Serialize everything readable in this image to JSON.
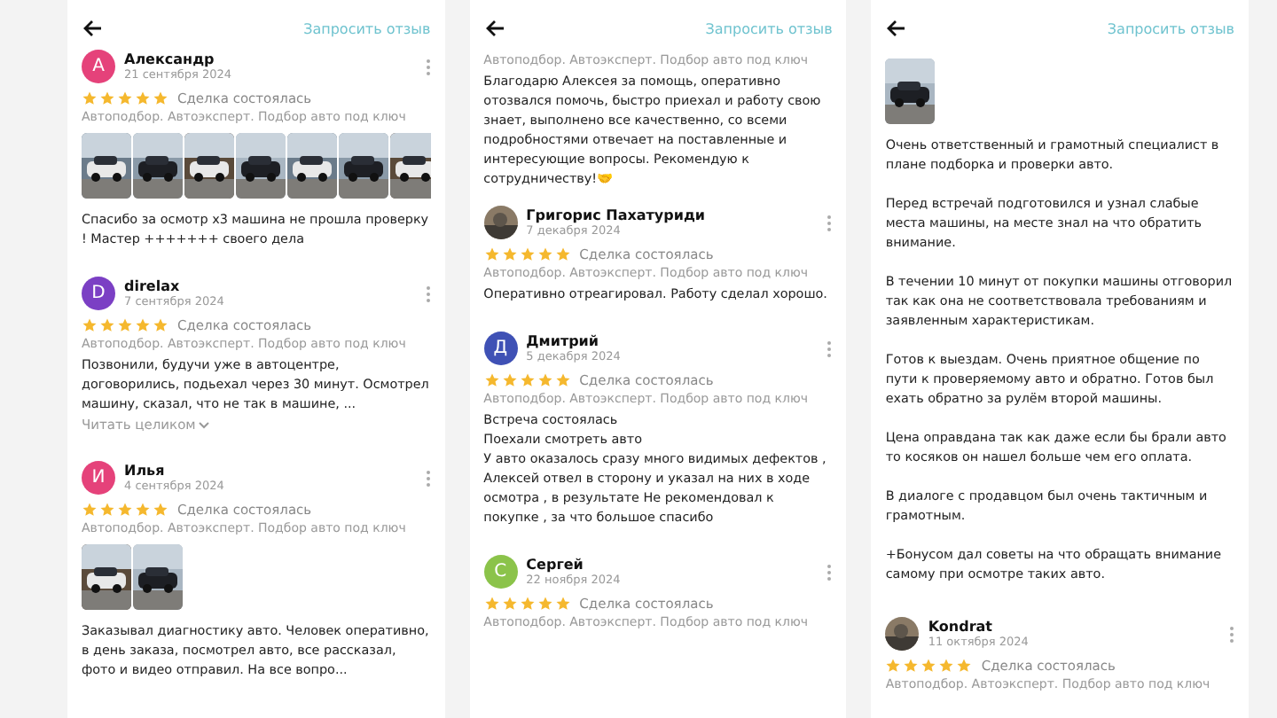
{
  "panels": [
    {
      "request_link": "Запросить отзыв",
      "items": [
        {
          "kind": "review",
          "avatar": {
            "letter": "А",
            "color": "#e5427a"
          },
          "name": "Александр",
          "date": "21 сентября 2024",
          "stars": 5,
          "deal": "Сделка состоялась",
          "category": "Автоподбор. Автоэксперт. Подбор авто под ключ",
          "photos": [
            {
              "kind": "picture"
            },
            {
              "kind": "picture"
            },
            {
              "kind": "picture"
            },
            {
              "kind": "picture"
            },
            {
              "kind": "picture"
            },
            {
              "kind": "picture"
            },
            {
              "kind": "picture"
            }
          ],
          "text": [
            "Спасибо за осмотр х3 машина не прошла проверку ! Мастер +++++++ своего дела"
          ]
        },
        {
          "kind": "review",
          "avatar": {
            "letter": "D",
            "color": "#7b3fc4"
          },
          "name": "direlax",
          "date": "7 сентября 2024",
          "stars": 5,
          "deal": "Сделка состоялась",
          "category": "Автоподбор. Автоэксперт. Подбор авто под ключ",
          "text": [
            "Позвонили, будучи уже в автоцентре, договорились, подьехал через 30 минут. Осмотрел машину, сказал, что не так в машине, ..."
          ],
          "read_more": "Читать целиком"
        },
        {
          "kind": "review",
          "avatar": {
            "letter": "И",
            "color": "#e5427a"
          },
          "name": "Илья",
          "date": "4 сентября 2024",
          "stars": 5,
          "deal": "Сделка состоялась",
          "category": "Автоподбор. Автоэксперт. Подбор авто под ключ",
          "photos": [
            {
              "kind": "picture"
            },
            {
              "kind": "picture"
            }
          ],
          "text": [
            "Заказывал диагностику авто. Человек оперативно, в день заказа, посмотрел авто, все рассказал, фото и видео отправил. На все вопро..."
          ]
        }
      ]
    },
    {
      "request_link": "Запросить отзыв",
      "items": [
        {
          "kind": "continuation",
          "category": "Автоподбор. Автоэксперт. Подбор авто под ключ",
          "text": [
            "Благодарю Алексея за помощь, оперативно отозвался помочь, быстро приехал и работу свою знает, выполнено все качественно, со всеми подробностями отвечает на поставленные и интересующие вопросы. Рекомендую к сотрудничеству!🤝"
          ]
        },
        {
          "kind": "review",
          "avatar": {
            "kind": "picture"
          },
          "name": "Григорис Пахатуриди",
          "date": "7 декабря 2024",
          "stars": 5,
          "deal": "Сделка состоялась",
          "category": "Автоподбор. Автоэксперт. Подбор авто под ключ",
          "text": [
            "Оперативно отреагировал. Работу сделал хорошо."
          ]
        },
        {
          "kind": "review",
          "avatar": {
            "letter": "Д",
            "color": "#3f51b5"
          },
          "name": "Дмитрий",
          "date": "5 декабря 2024",
          "stars": 5,
          "deal": "Сделка состоялась",
          "category": "Автоподбор. Автоэксперт. Подбор авто под ключ",
          "text": [
            "Встреча состоялась\nПоехали смотреть авто\nУ авто оказалось сразу много видимых дефектов , Алексей отвел в сторону и указал на них в ходе осмотра , в результате Не рекомендовал к покупке , за что большое спасибо"
          ]
        },
        {
          "kind": "review",
          "avatar": {
            "letter": "С",
            "color": "#8bc34a"
          },
          "name": "Сергей",
          "date": "22 ноября 2024",
          "stars": 5,
          "deal": "Сделка состоялась",
          "category": "Автоподбор. Автоэксперт. Подбор авто под ключ"
        }
      ]
    },
    {
      "request_link": "Запросить отзыв",
      "items": [
        {
          "kind": "continuation",
          "photos": [
            {
              "kind": "picture"
            }
          ],
          "text": [
            "Очень ответственный и грамотный специалист в плане подборка и проверки авто.",
            "Перед встречай подготовился и узнал слабые места машины, на месте знал на что обратить внимание.",
            "В течении 10 минут от покупки машины отговорил так как она не соответствовала требованиям и заявленным характеристикам.",
            "Готов к выездам. Очень приятное общение по пути к проверяемому авто и обратно. Готов был ехать обратно за рулём второй машины.",
            "Цена оправдана так как даже если бы брали авто то косяков он нашел больше чем его оплата.",
            "В диалоге с продавцом был очень тактичным и грамотным.",
            "+Бонусом дал советы на что обращать внимание самому при осмотре таких авто."
          ]
        },
        {
          "kind": "review",
          "avatar": {
            "kind": "picture"
          },
          "name": "Kondrat",
          "date": "11 октября 2024",
          "stars": 5,
          "deal": "Сделка состоялась",
          "category": "Автоподбор. Автоэксперт. Подбор авто под ключ"
        }
      ]
    }
  ]
}
